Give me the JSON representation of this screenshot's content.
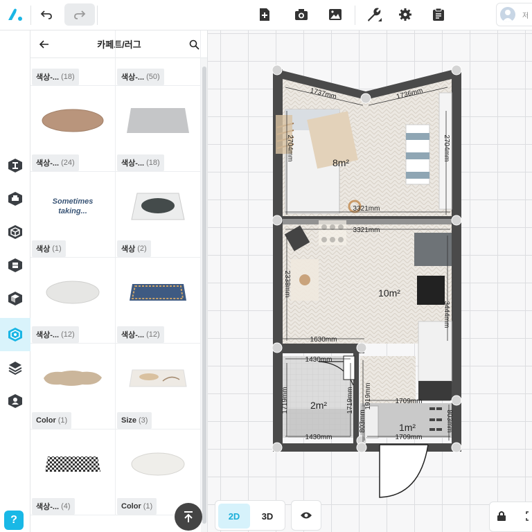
{
  "toolbar": {
    "logo": "logo-icon",
    "undo": "undo-icon",
    "redo": "redo-icon",
    "new_page": "add-page-icon",
    "camera": "camera-icon",
    "image": "image-icon",
    "tools": "wrench-icon",
    "settings": "gear-icon",
    "clipboard": "clipboard-icon",
    "user_initial": "저"
  },
  "panel": {
    "title": "카페트/러그",
    "items": [
      {
        "label": "색상-...",
        "count": "(18)"
      },
      {
        "label": "색상-...",
        "count": "(50)"
      },
      {
        "label": "색상-...",
        "count": "(24)"
      },
      {
        "label": "색상-...",
        "count": "(18)"
      },
      {
        "label": "색상",
        "count": "(1)",
        "rug_text": "Sometimes taking..."
      },
      {
        "label": "색상",
        "count": "(2)"
      },
      {
        "label": "색상-...",
        "count": "(12)"
      },
      {
        "label": "색상-...",
        "count": "(12)"
      },
      {
        "label": "Color",
        "count": "(1)"
      },
      {
        "label": "Size",
        "count": "(3)"
      },
      {
        "label": "색상-...",
        "count": "(4)"
      },
      {
        "label": "Color",
        "count": "(1)"
      }
    ]
  },
  "view_modes": {
    "two_d": "2D",
    "three_d": "3D"
  },
  "floorplan": {
    "rooms": [
      {
        "area": "8m²"
      },
      {
        "area": "10m²"
      },
      {
        "area": "2m²"
      },
      {
        "area": "1m²"
      }
    ],
    "dimensions": {
      "top_left_wall": "1737mm",
      "top_right_wall": "1736mm",
      "left_upper": "2704mm",
      "right_upper": "2704mm",
      "width_a": "3321mm",
      "width_b": "3321mm",
      "left_middle": "2338mm",
      "right_middle": "3444mm",
      "bath_width": "1630mm",
      "bath_inner": "1430mm",
      "bath_left": "1719mm",
      "bath_right": "1719mm",
      "door_h": "1919mm",
      "hall_width": "1709mm",
      "hall_right": "803mm",
      "hall_left": "803mm",
      "bottom_left": "1430mm",
      "bottom_right": "1709mm"
    }
  }
}
